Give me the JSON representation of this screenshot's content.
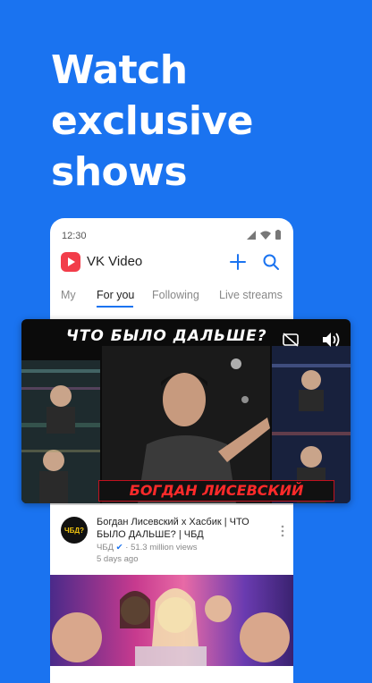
{
  "headline": [
    "Watch",
    "exclusive",
    "shows"
  ],
  "status": {
    "time": "12:30"
  },
  "app": {
    "title": "VK Video"
  },
  "tabs": [
    {
      "label": "My"
    },
    {
      "label": "For you"
    },
    {
      "label": "Following"
    },
    {
      "label": "Live streams"
    }
  ],
  "player": {
    "title_overlay": "ЧТО БЫЛО ДАЛЬШЕ?",
    "name_overlay": "БОГДАН ЛИСЕВСКИЙ"
  },
  "video": {
    "title": "Богдан Лисевский х Хасбик | ЧТО БЫЛО ДАЛЬШЕ? | ЧБД",
    "channel": "ЧБД",
    "views": "51.3 million views",
    "age": "5 days ago",
    "avatar_text": "ЧБД?"
  },
  "colors": {
    "brand_blue": "#1a73f0",
    "logo_red": "#f23d4a"
  }
}
